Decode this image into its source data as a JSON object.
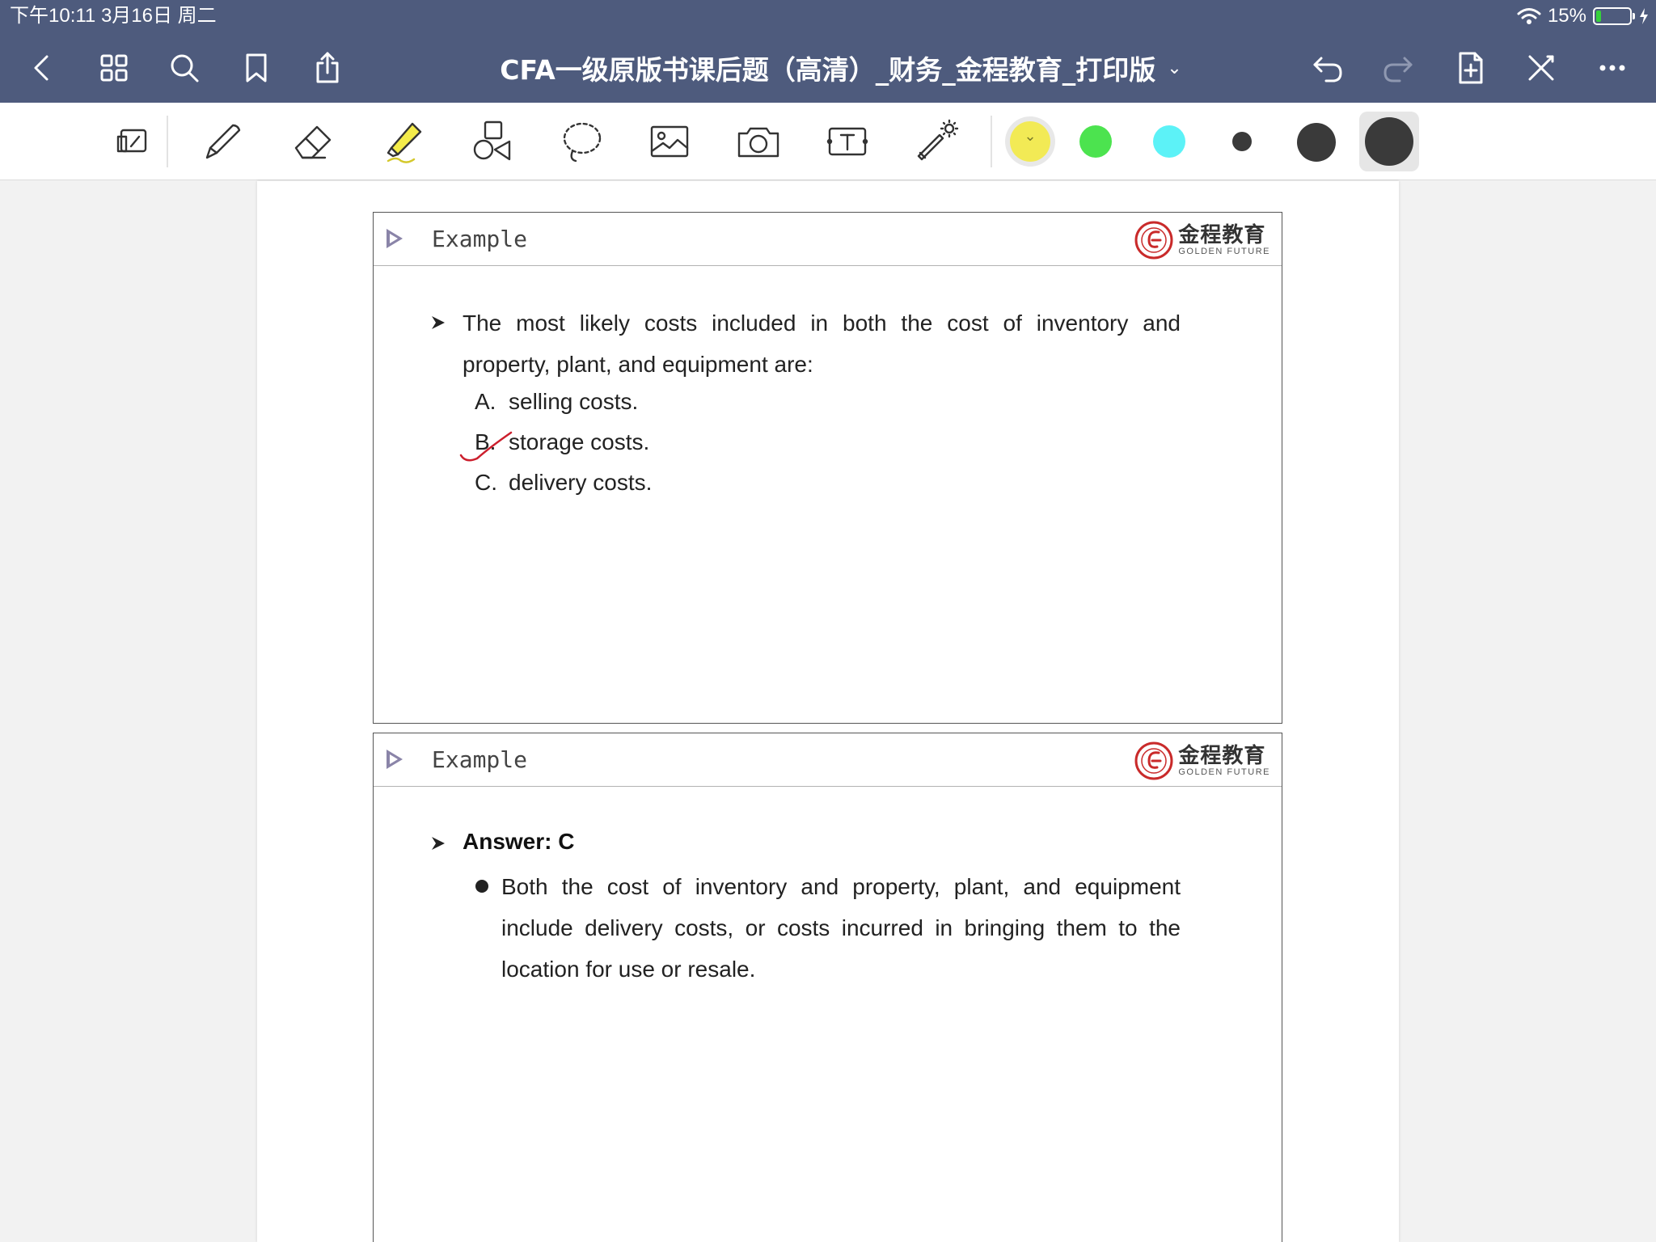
{
  "status_bar": {
    "time_date": "下午10:11   3月16日 周二",
    "battery_percent": "15%",
    "battery_level": 0.15
  },
  "nav": {
    "title": "CFA一级原版书课后题（高清）_财务_金程教育_打印版",
    "title_chevron": "⌄"
  },
  "toolbar": {
    "colors": [
      "#f2ea55",
      "#4ce34f",
      "#5cf2f7",
      "#3a3a3a",
      "#3a3a3a",
      "#3a3a3a"
    ],
    "selected_color_chevron": "⌄"
  },
  "slides": [
    {
      "title": "Example",
      "logo_cn": "金程教育",
      "logo_en": "GOLDEN FUTURE",
      "question": "The most likely costs included in both the cost of inventory and property, plant, and equipment are:",
      "options": [
        {
          "letter": "A.",
          "text": "selling costs."
        },
        {
          "letter": "B.",
          "text": "storage costs."
        },
        {
          "letter": "C.",
          "text": "delivery costs."
        }
      ]
    },
    {
      "title": "Example",
      "logo_cn": "金程教育",
      "logo_en": "GOLDEN FUTURE",
      "answer_label": "Answer: C",
      "explanation": "Both the cost of inventory and property, plant, and equipment include delivery costs, or costs incurred in bringing them to the location for use or resale."
    }
  ]
}
